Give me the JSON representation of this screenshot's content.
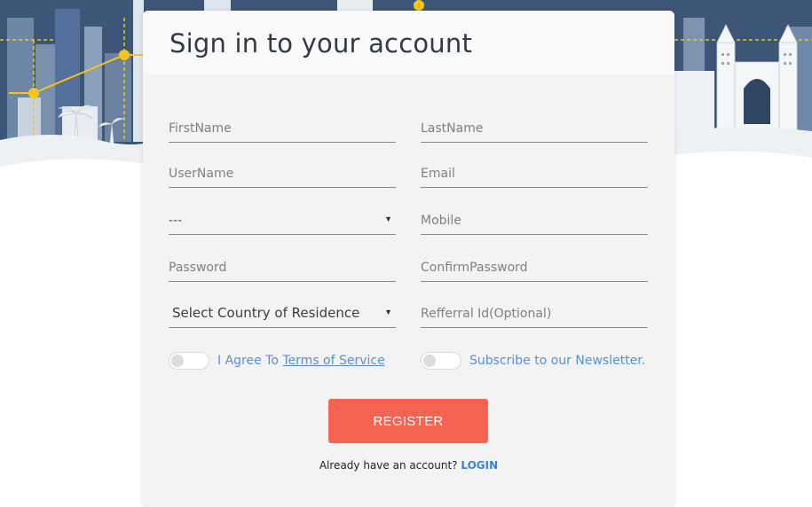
{
  "form": {
    "title": "Sign in to your account",
    "fields": {
      "first_name": {
        "placeholder": "FirstName",
        "value": ""
      },
      "last_name": {
        "placeholder": "LastName",
        "value": ""
      },
      "user_name": {
        "placeholder": "UserName",
        "value": ""
      },
      "email": {
        "placeholder": "Email",
        "value": ""
      },
      "prefix_select": {
        "selected": "---"
      },
      "mobile": {
        "placeholder": "Mobile",
        "value": ""
      },
      "password": {
        "placeholder": "Password",
        "value": ""
      },
      "confirm_password": {
        "placeholder": "ConfirmPassword",
        "value": ""
      },
      "country_select": {
        "selected": "Select Country of Residence"
      },
      "referral_id": {
        "placeholder": "Refferral Id(Optional)",
        "value": ""
      }
    },
    "agree_toggle": {
      "prefix": "I Agree To ",
      "link_text": "Terms of Service",
      "checked": false
    },
    "newsletter_toggle": {
      "label": "Subscribe to our Newsletter.",
      "checked": false
    },
    "register_label": "REGISTER",
    "login_prompt": "Already have an account?",
    "login_link": "LOGIN"
  },
  "colors": {
    "accent_button": "#f66350",
    "link": "#3b82e0",
    "toggle_text": "#5b8fd4",
    "sky": "#3b5478",
    "chart_line": "#f5c518"
  },
  "icons": {
    "select_caret": "caret-down-icon"
  }
}
